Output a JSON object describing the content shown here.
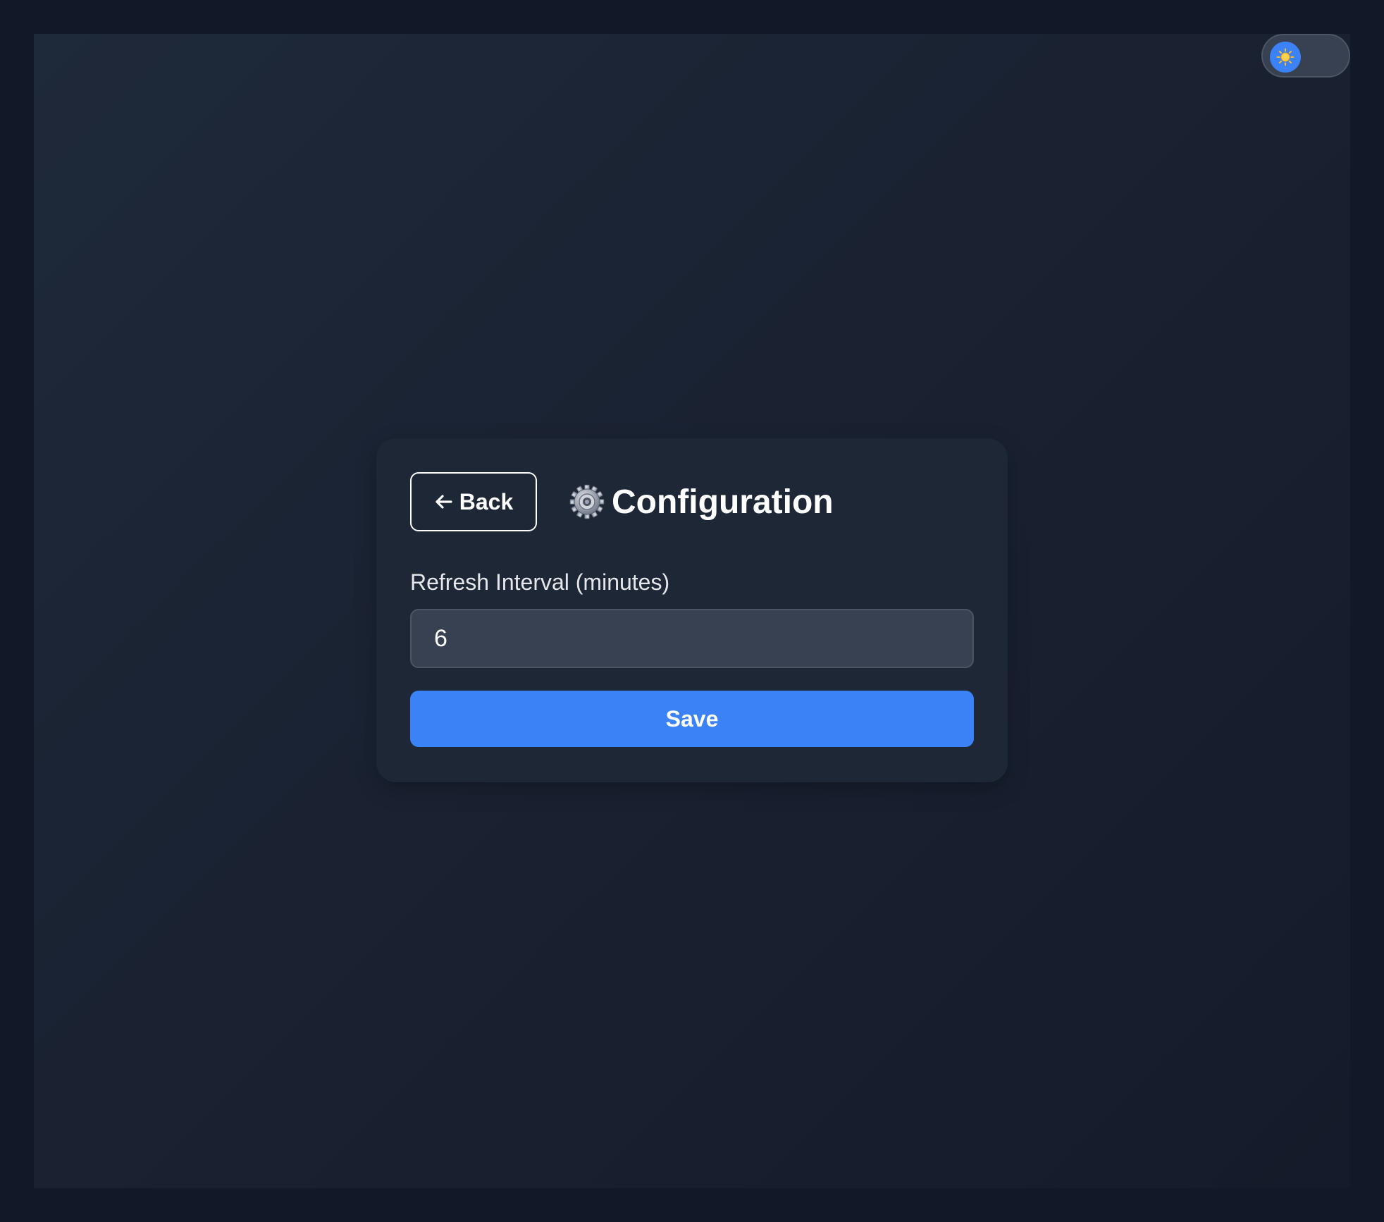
{
  "theme_toggle": {
    "icon": "sun-icon",
    "state": "light"
  },
  "config": {
    "back_label": "Back",
    "back_icon": "arrow-left-icon",
    "title_icon": "gear-icon",
    "title": "Configuration",
    "interval_label": "Refresh Interval (minutes)",
    "interval_value": "6",
    "save_label": "Save"
  },
  "colors": {
    "page_bg": "#111827",
    "card_bg": "#1e2736",
    "accent": "#3b82f6",
    "input_bg": "#374151",
    "toggle_sun": "#fbbf24"
  }
}
